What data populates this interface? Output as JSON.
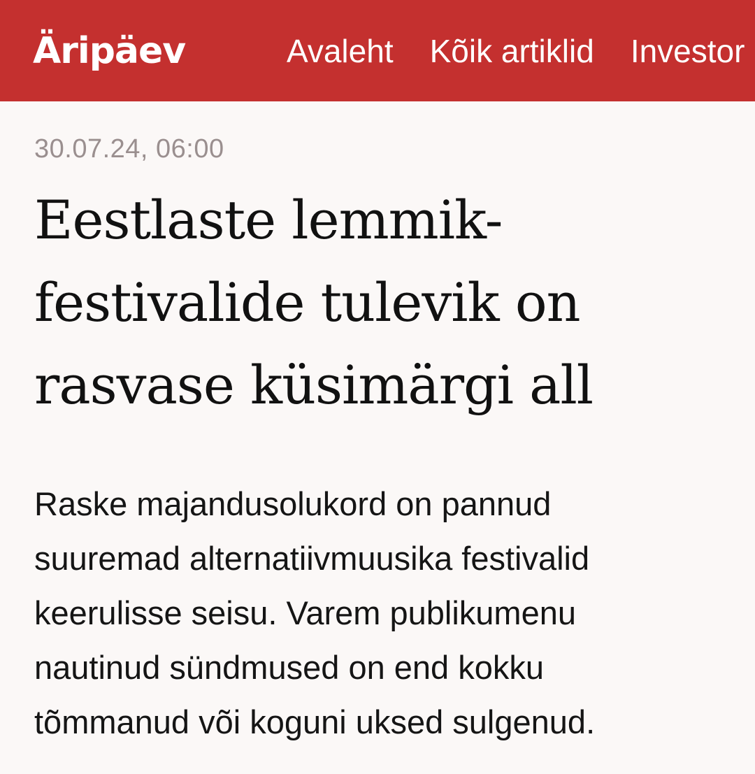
{
  "header": {
    "logo_text": "Äripäev",
    "nav": [
      "Avaleht",
      "Kõik artiklid",
      "Investor"
    ],
    "background_color": "#c4302f"
  },
  "article": {
    "date": "30.07.24, 06:00",
    "headline_lines": [
      "Eestlaste lemmik-",
      "festivalide tulevik on",
      "rasvase küsimärgi all"
    ],
    "lead_lines": [
      "Raske majandusolukord on pannud",
      "suuremad alternatiivmuusika festivalid",
      "keerulisse seisu. Varem publikumenu",
      "nautinud sündmused on end kokku",
      "tõmmanud või koguni uksed sulgenud."
    ]
  }
}
